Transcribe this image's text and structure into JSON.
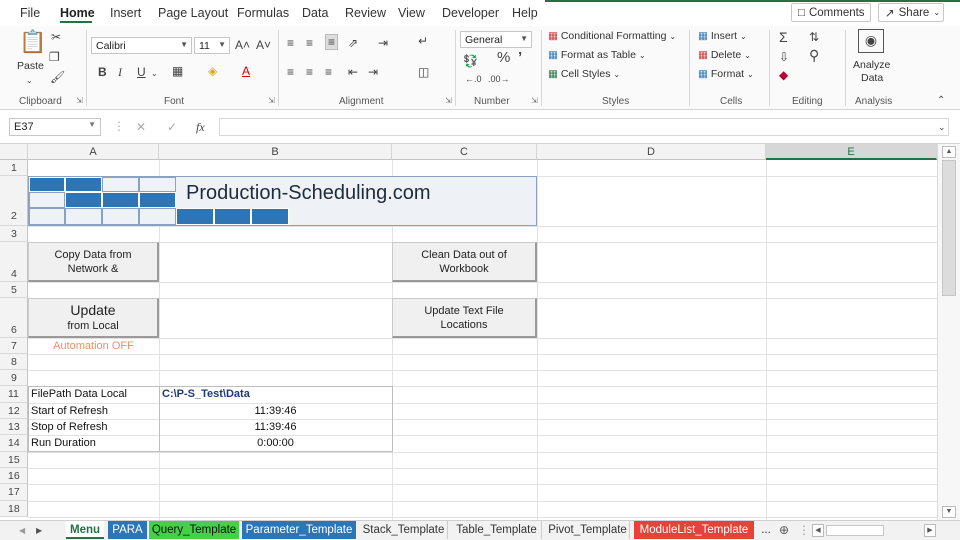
{
  "menu": {
    "tabs": [
      "File",
      "Home",
      "Insert",
      "Page Layout",
      "Formulas",
      "Data",
      "Review",
      "View",
      "Developer",
      "Help"
    ],
    "comments_label": "Comments",
    "share_label": "Share"
  },
  "ribbon": {
    "clipboard": {
      "paste_label": "Paste",
      "group_label": "Clipboard"
    },
    "font": {
      "font_name": "Calibri",
      "font_size": "11",
      "grow": "A˄",
      "shrink": "A˅",
      "bold": "B",
      "italic": "I",
      "underline": "U",
      "group_label": "Font"
    },
    "alignment": {
      "group_label": "Alignment"
    },
    "number": {
      "format": "General",
      "percent": "%",
      "comma": "’",
      "group_label": "Number"
    },
    "styles": {
      "conditional": "Conditional Formatting",
      "format_table": "Format as Table",
      "cell_styles": "Cell Styles",
      "group_label": "Styles"
    },
    "cells": {
      "insert": "Insert",
      "delete": "Delete",
      "format": "Format",
      "group_label": "Cells"
    },
    "editing": {
      "group_label": "Editing"
    },
    "analysis": {
      "analyze_line1": "Analyze",
      "analyze_line2": "Data",
      "group_label": "Analysis"
    }
  },
  "formula_bar": {
    "name_box": "E37",
    "fx": "fx",
    "formula": ""
  },
  "grid": {
    "columns": [
      "A",
      "B",
      "C",
      "D",
      "E"
    ],
    "selected_column": "E",
    "rows": [
      "1",
      "2",
      "3",
      "4",
      "5",
      "6",
      "7",
      "8",
      "9",
      "11",
      "12",
      "13",
      "14",
      "15",
      "16",
      "17",
      "18"
    ],
    "logo_text": "Production-Scheduling.com",
    "buttons": {
      "copy_line1": "Copy Data from",
      "copy_line2": "Network &",
      "clean_line1": "Clean Data out of",
      "clean_line2": "Workbook",
      "update_line1": "Update",
      "update_line2": "from Local",
      "update_text_line1": "Update Text File",
      "update_text_line2": "Locations"
    },
    "automation_status": "Automation OFF",
    "table": [
      {
        "label": "FilePath Data Local",
        "value": "C:\\P-S_Test\\Data"
      },
      {
        "label": "Start of Refresh",
        "value": "11:39:46"
      },
      {
        "label": "Stop of Refresh",
        "value": "11:39:46"
      },
      {
        "label": "Run Duration",
        "value": "0:00:00"
      }
    ]
  },
  "sheet_tabs": [
    {
      "label": "Menu",
      "color": "#ffffff"
    },
    {
      "label": "PARA",
      "color": "#2e75b6"
    },
    {
      "label": "Query_Template",
      "color": "#44d14a"
    },
    {
      "label": "Parameter_Template",
      "color": "#2e75b6"
    },
    {
      "label": "Stack_Template",
      "color": ""
    },
    {
      "label": "Table_Template",
      "color": ""
    },
    {
      "label": "Pivot_Template",
      "color": ""
    },
    {
      "label": "ModuleList_Template",
      "color": "#e8403a"
    },
    {
      "label": "...",
      "color": ""
    }
  ],
  "colors": {
    "accent": "#217346",
    "logo_blue": "#2e75b6",
    "automation_text": "#e8906a"
  }
}
